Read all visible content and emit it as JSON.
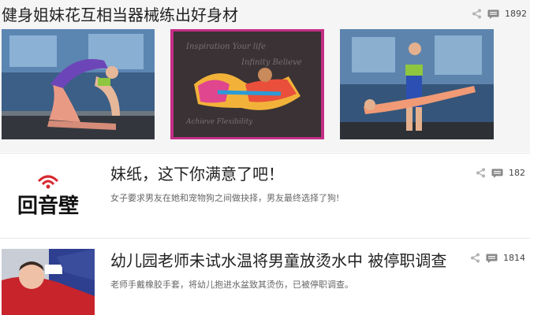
{
  "feed": [
    {
      "title": "健身姐妹花互相当器械练出好身材",
      "comment_count": "1892",
      "icons": [
        "share-icon",
        "comment-icon"
      ],
      "images": [
        "gym-yoga-pose-photo",
        "yoga-pose-doodle-background-photo",
        "gym-partner-stretch-photo"
      ]
    },
    {
      "title": "妹纸，这下你满意了吧！",
      "summary": "女子要求男友在她和宠物狗之间做抉择，男友最终选择了狗!",
      "comment_count": "182",
      "thumbnail_text": "回音壁"
    },
    {
      "title": "幼儿园老师未试水温将男童放烫水中 被停职调查",
      "summary": "老师手戴橡胶手套，将幼儿抱进水盆致其烫伤，已被停职调查。",
      "comment_count": "1814",
      "thumbnail": "injured-child-photo"
    }
  ],
  "colors": {
    "icon_grey": "#b3b3b3",
    "item_bg": "#f5f5f5",
    "logo_red": "#d9282f"
  }
}
